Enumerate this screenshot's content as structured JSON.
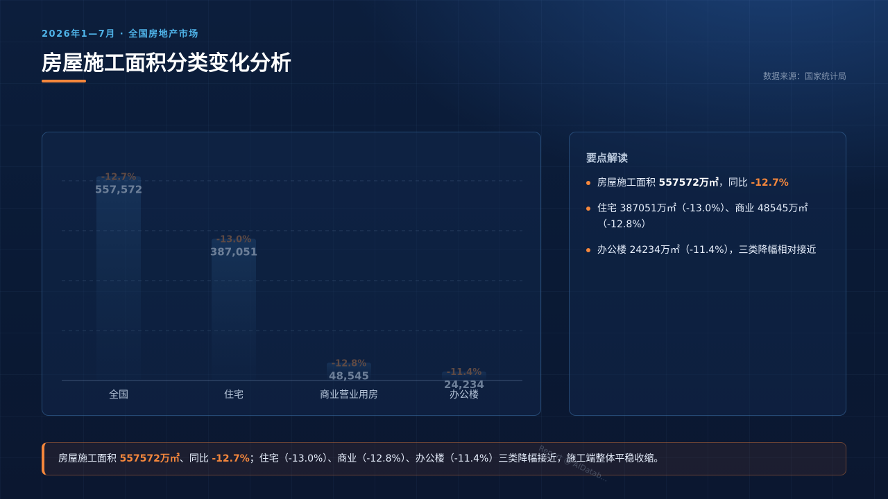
{
  "header": {
    "eyebrow": "2026年1—7月 · 全国房地产市场",
    "title": "房屋施工面积分类变化分析",
    "source": "数据来源：国家统计局"
  },
  "chart_data": {
    "type": "bar",
    "categories": [
      "全国",
      "住宅",
      "商业营业用房",
      "办公楼"
    ],
    "values": [
      557572,
      387051,
      48545,
      24234
    ],
    "value_labels": [
      "557,572",
      "387,051",
      "48,545",
      "24,234"
    ],
    "yoy_labels": [
      "-12.7%",
      "-13.0%",
      "-12.8%",
      "-11.4%"
    ],
    "ylim": [
      0,
      600000
    ],
    "grid": true,
    "colors": {
      "bar": "#1d3d66",
      "bar_top": "#2a5a8c"
    }
  },
  "insights": {
    "heading": "要点解读",
    "items": [
      {
        "a": "房屋施工面积 ",
        "b": "557572万㎡",
        "c": "，同比 ",
        "d": "-12.7%"
      },
      {
        "a": "住宅 387051万㎡（-13.0%）、商业 48545万㎡（-12.8%）"
      },
      {
        "a": "办公楼 24234万㎡（-11.4%），三类降幅相对接近"
      }
    ]
  },
  "conclusion": {
    "p1": "房屋施工面积 ",
    "b1": "557572万㎡",
    "p2": "、同比 ",
    "b2": "-12.7%",
    "p3": "；住宅（-13.0%）、商业（-12.8%）、办公楼（-11.4%）三类降幅接近，施工端整体平稳收缩。"
  },
  "watermark": "Report @ AIDatab..."
}
